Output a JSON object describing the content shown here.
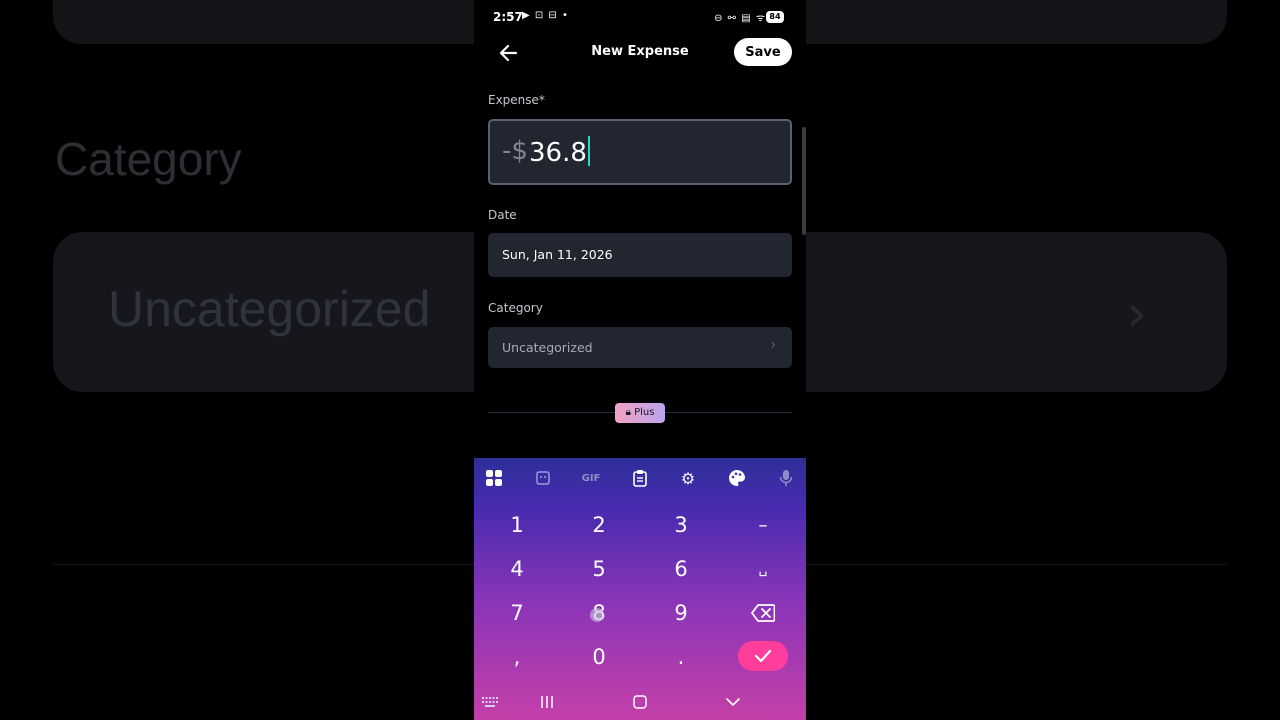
{
  "background": {
    "label": "Category",
    "card_text": "Uncategorized",
    "chevron": "›"
  },
  "status_bar": {
    "time": "2:57",
    "left_icons": "▶ ⊡ ⊟ •",
    "right_icons": "⊖ ⚯ ▤ ᯤ",
    "battery": "84"
  },
  "app_bar": {
    "title": "New Expense",
    "save_label": "Save"
  },
  "form": {
    "expense_label": "Expense*",
    "amount_sign": "-$",
    "amount_value": "36.8",
    "date_label": "Date",
    "date_value": "Sun, Jan 11, 2026",
    "category_label": "Category",
    "category_value": "Uncategorized",
    "plus_badge": "Plus"
  },
  "keyboard": {
    "toolbar": {
      "gif": "GIF"
    },
    "keys": {
      "k1": "1",
      "k2": "2",
      "k3": "3",
      "minus": "–",
      "k4": "4",
      "k5": "5",
      "k6": "6",
      "space": "␣",
      "k7": "7",
      "k8": "8",
      "k9": "9",
      "comma": ",",
      "k0": "0",
      "period": "."
    }
  },
  "colors": {
    "accent_check": "#ff3d9a",
    "caret": "#2bd8c4",
    "field_bg": "#222630"
  }
}
